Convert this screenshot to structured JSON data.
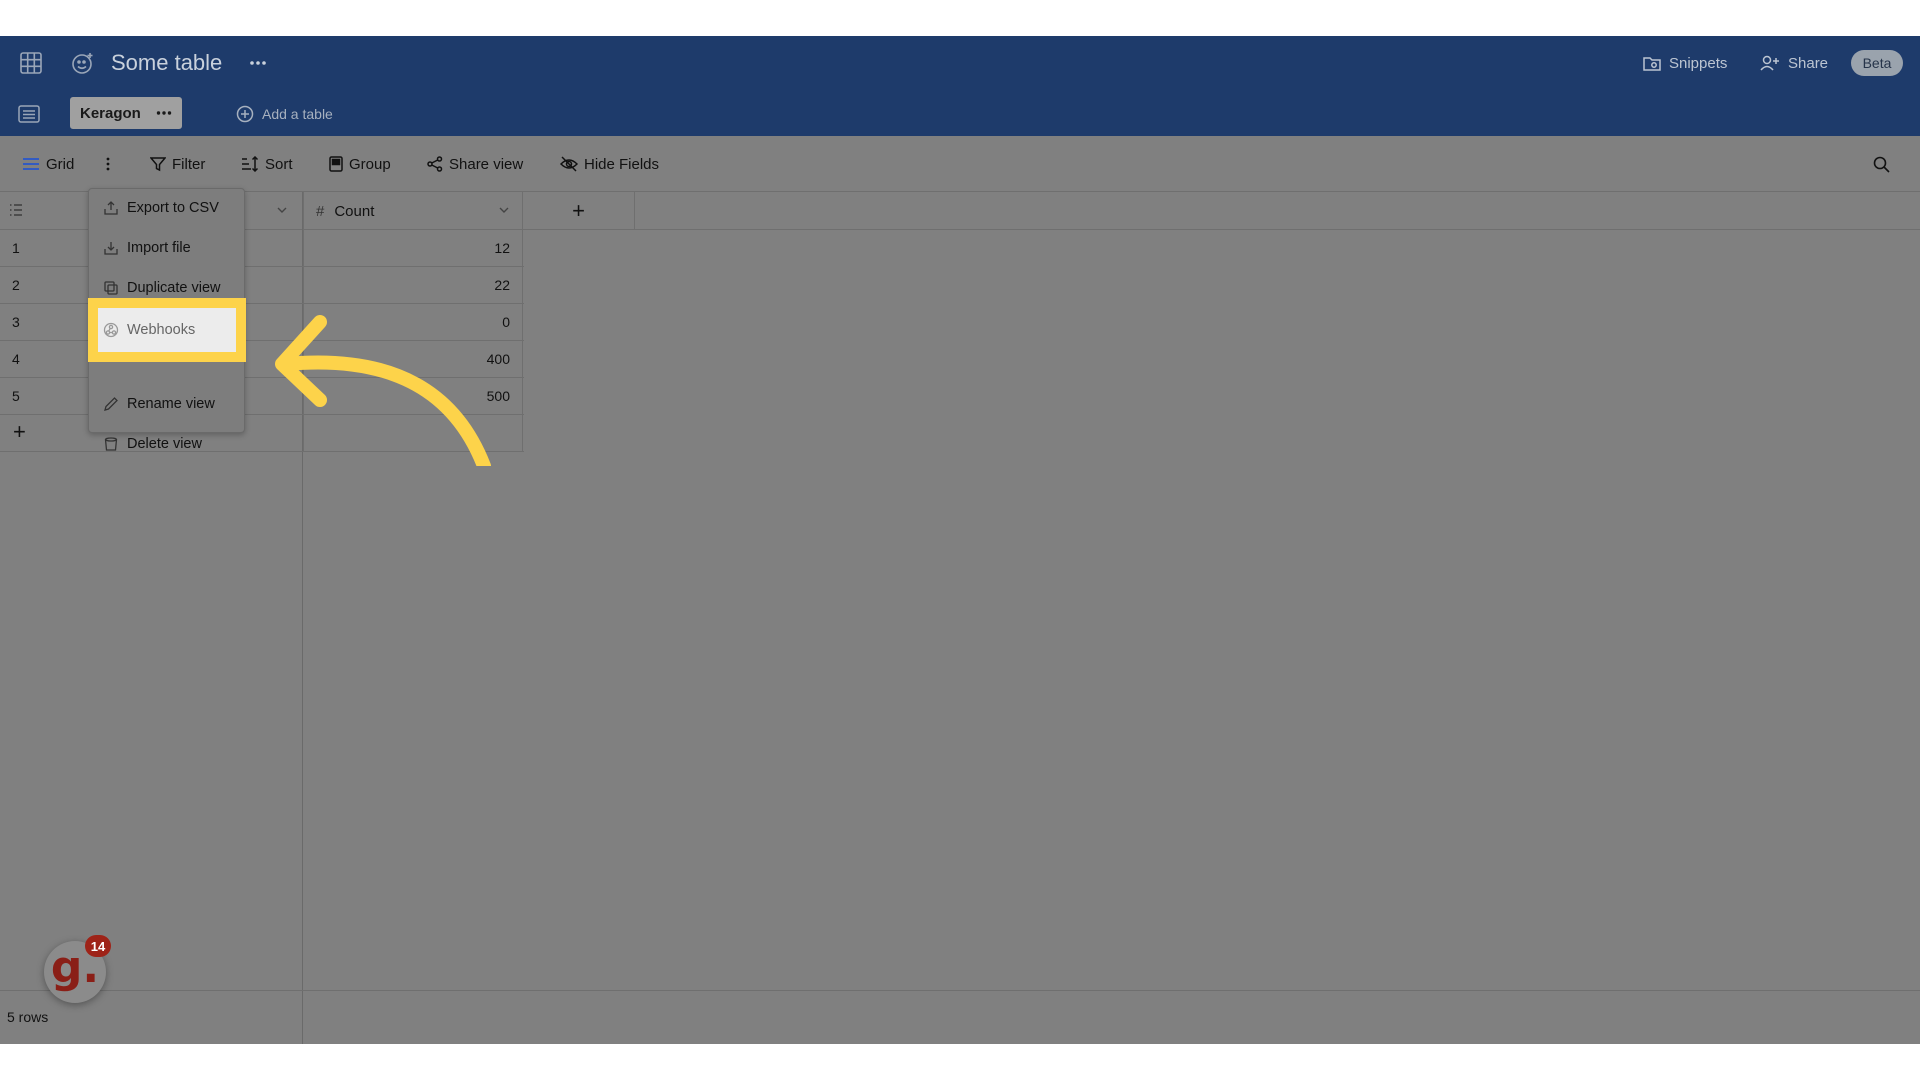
{
  "header": {
    "title": "Some table",
    "snippets_label": "Snippets",
    "share_label": "Share",
    "beta_label": "Beta",
    "table_tab": "Keragon",
    "add_table_label": "Add a table"
  },
  "toolbar": {
    "grid_label": "Grid",
    "filter_label": "Filter",
    "sort_label": "Sort",
    "group_label": "Group",
    "share_view_label": "Share view",
    "hide_fields_label": "Hide Fields"
  },
  "columns": {
    "count_label": "Count",
    "count_type_symbol": "#"
  },
  "rows": [
    {
      "num": "1",
      "count": "12"
    },
    {
      "num": "2",
      "count": "22"
    },
    {
      "num": "3",
      "count": "0"
    },
    {
      "num": "4",
      "count": "400"
    },
    {
      "num": "5",
      "count": "500"
    }
  ],
  "add_row_symbol": "+",
  "add_column_symbol": "+",
  "footer": {
    "row_count": "5 rows"
  },
  "menu": {
    "export_label": "Export to CSV",
    "import_label": "Import file",
    "duplicate_label": "Duplicate view",
    "webhooks_label": "Webhooks",
    "rename_label": "Rename view",
    "delete_label": "Delete view"
  },
  "guide_badge": {
    "letter": "g.",
    "count": "14"
  },
  "colors": {
    "header_bg": "#1e3b6b",
    "overlay": "#808080",
    "highlight": "#fdd34a"
  }
}
